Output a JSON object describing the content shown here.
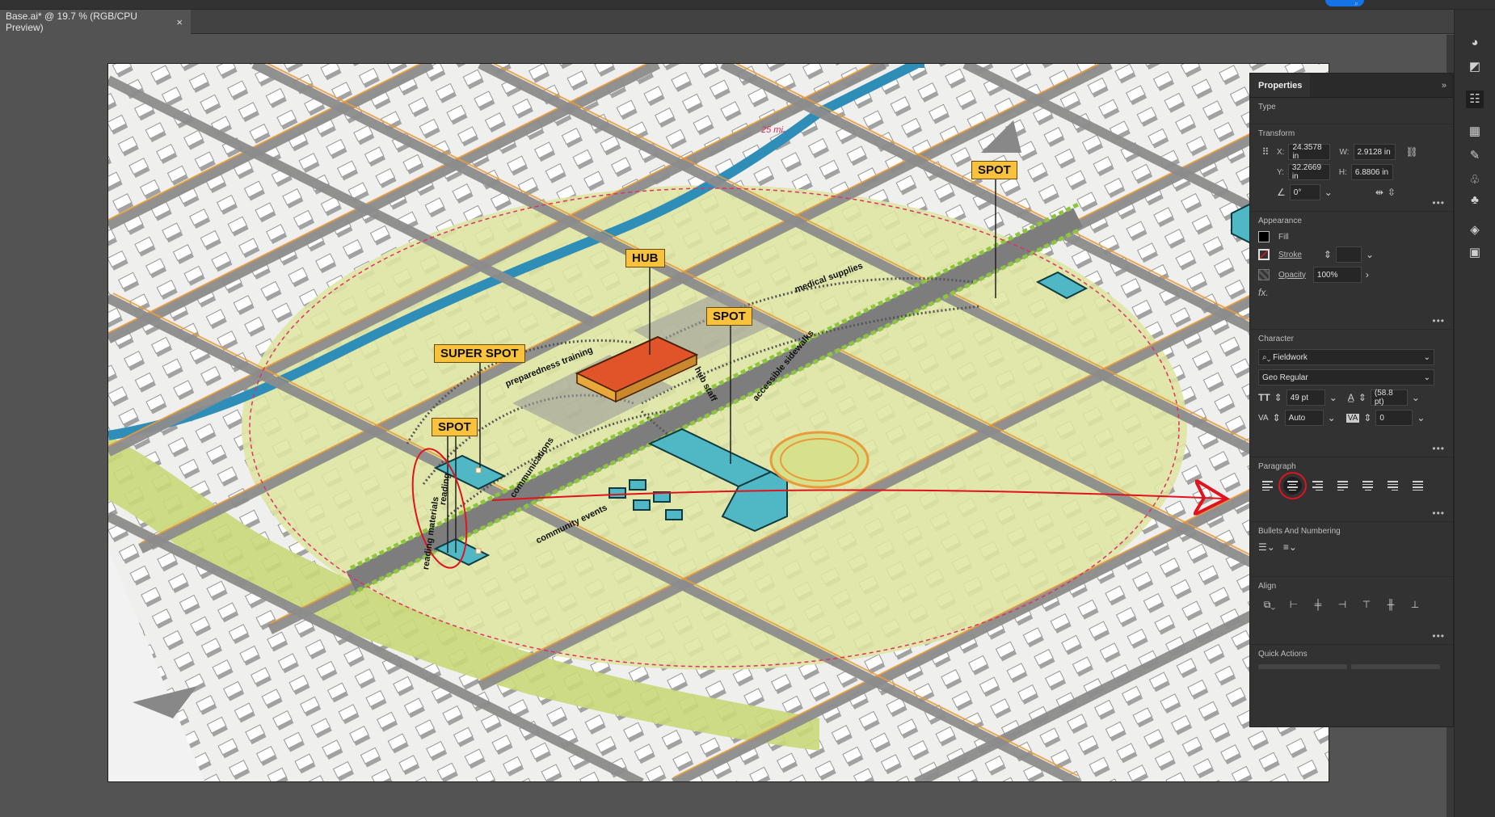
{
  "document_tab": {
    "title": "Base.ai* @ 19.7 % (RGB/CPU Preview)",
    "close": "×"
  },
  "map": {
    "labels": {
      "hub": "HUB",
      "super_spot": "SUPER SPOT",
      "spot_top_right": "SPOT",
      "spot_center": "SPOT",
      "spot_left": "SPOT"
    },
    "annotations": {
      "radius": "25 mi.",
      "medical": "medical supplies",
      "preparedness": "preparedness training",
      "sidewalks": "accessible sidewalks",
      "hub_staff": "hub staff",
      "communications": "communications",
      "community_events": "community events",
      "reading_materials": "reading materials",
      "reading_2": "reading"
    },
    "colors": {
      "zone": "#dfe6a0",
      "roads": "#8a8a8a",
      "road_edge": "#e99a3a",
      "river": "#2f8eb8",
      "buildings_highlight": "#4fb8c4",
      "hub_building": "#e1542a",
      "label_fill": "#f9c23c",
      "radius_circle": "#e0306a",
      "markup_red": "#e0141e"
    }
  },
  "properties": {
    "tab": "Properties",
    "collapse": "»",
    "type_section": "Type",
    "transform": {
      "title": "Transform",
      "x_label": "X:",
      "x": "24.3578 in",
      "y_label": "Y:",
      "y": "32.2669 in",
      "w_label": "W:",
      "w": "2.9128 in",
      "h_label": "H:",
      "h": "6.8806 in",
      "angle": "0°"
    },
    "appearance": {
      "title": "Appearance",
      "fill": "Fill",
      "stroke": "Stroke",
      "opacity_label": "Opacity",
      "opacity": "100%",
      "fx": "fx."
    },
    "character": {
      "title": "Character",
      "font": "Fieldwork",
      "style": "Geo Regular",
      "size": "49 pt",
      "leading": "(58.8 pt)",
      "kerning": "Auto",
      "tracking": "0"
    },
    "paragraph": {
      "title": "Paragraph"
    },
    "bullets": {
      "title": "Bullets And Numbering"
    },
    "align": {
      "title": "Align"
    },
    "quick_actions": {
      "title": "Quick Actions"
    },
    "more": "•••"
  }
}
